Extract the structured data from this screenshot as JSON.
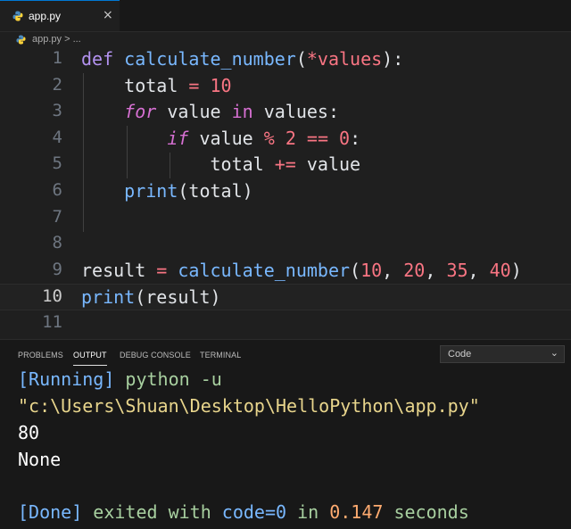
{
  "tab": {
    "filename": "app.py",
    "close": "×"
  },
  "breadcrumb": {
    "text": "app.py > ..."
  },
  "editor": {
    "line_numbers": [
      "1",
      "2",
      "3",
      "4",
      "5",
      "6",
      "7",
      "8",
      "9",
      "10",
      "11"
    ],
    "code": {
      "l1": {
        "def": "def",
        "fname": "calculate_number",
        "open": "(",
        "star": "*",
        "param": "values",
        "close": "):"
      },
      "l2": {
        "var": "total",
        "eq": " = ",
        "num": "10"
      },
      "l3": {
        "for": "for",
        "var": " value ",
        "in": "in",
        "iter": " values:"
      },
      "l4": {
        "if": "if",
        "var": " value ",
        "mod": "%",
        "sp1": " ",
        "two": "2",
        "sp2": " ",
        "eqeq": "==",
        "sp3": " ",
        "zero": "0",
        "colon": ":"
      },
      "l5": {
        "var": "total ",
        "pluseq": "+=",
        "rest": " value"
      },
      "l6": {
        "print": "print",
        "args": "(total)"
      },
      "l9": {
        "var": "result",
        "eq": " = ",
        "fname": "calculate_number",
        "open": "(",
        "n1": "10",
        "c1": ", ",
        "n2": "20",
        "c2": ", ",
        "n3": "35",
        "c3": ", ",
        "n4": "40",
        "close": ")"
      },
      "l10": {
        "print": "print",
        "args": "(result)"
      }
    }
  },
  "panel": {
    "tabs": [
      "PROBLEMS",
      "OUTPUT",
      "DEBUG CONSOLE",
      "TERMINAL"
    ],
    "active_tab": "OUTPUT",
    "select_value": "Code",
    "output": {
      "running_tag": "[Running]",
      "command": " python -u",
      "path": "\"c:\\Users\\Shuan\\Desktop\\HelloPython\\app.py\"",
      "result1": "80",
      "result2": "None",
      "done_tag": "[Done]",
      "done_text1": " exited with ",
      "done_code": "code=0",
      "done_text2": " in ",
      "done_time": "0.147",
      "done_text3": " seconds"
    }
  }
}
